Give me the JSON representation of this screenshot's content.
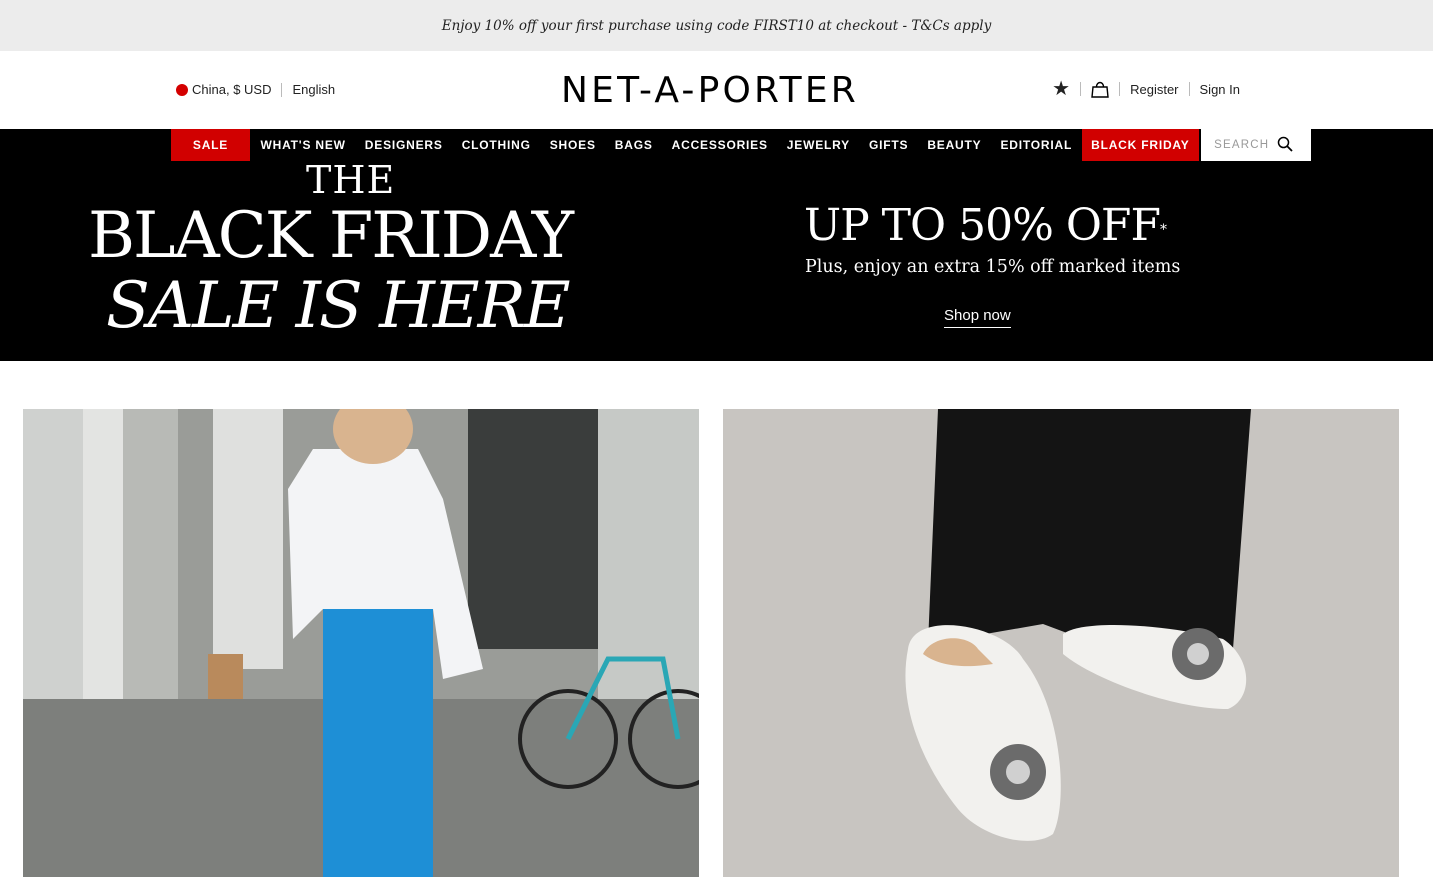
{
  "promo": {
    "text": "Enjoy 10% off your first purchase using code FIRST10 at checkout - T&Cs apply"
  },
  "header": {
    "locale": "China, $ USD",
    "language": "English",
    "logo": "NET-A-PORTER",
    "register": "Register",
    "sign_in": "Sign In",
    "icons": [
      "star-icon",
      "shopping-bag-icon"
    ]
  },
  "nav": {
    "items": [
      {
        "label": "SALE",
        "highlight": true
      },
      {
        "label": "WHAT'S NEW"
      },
      {
        "label": "DESIGNERS"
      },
      {
        "label": "CLOTHING"
      },
      {
        "label": "SHOES"
      },
      {
        "label": "BAGS"
      },
      {
        "label": "ACCESSORIES"
      },
      {
        "label": "JEWELRY"
      },
      {
        "label": "GIFTS"
      },
      {
        "label": "BEAUTY"
      },
      {
        "label": "EDITORIAL"
      },
      {
        "label": "BLACK FRIDAY",
        "highlight": true
      }
    ],
    "search_placeholder": "SEARCH"
  },
  "hero": {
    "the": "THE",
    "line1": "BLACK FRIDAY",
    "line2": "SALE IS HERE",
    "offer": "UP TO 50% OFF",
    "asterisk": "*",
    "sub": "Plus, enjoy an extra 15% off marked items",
    "cta": "Shop now"
  },
  "colors": {
    "accent_red": "#d10000",
    "nav_bg": "#000000",
    "promo_bg": "#ececec"
  }
}
